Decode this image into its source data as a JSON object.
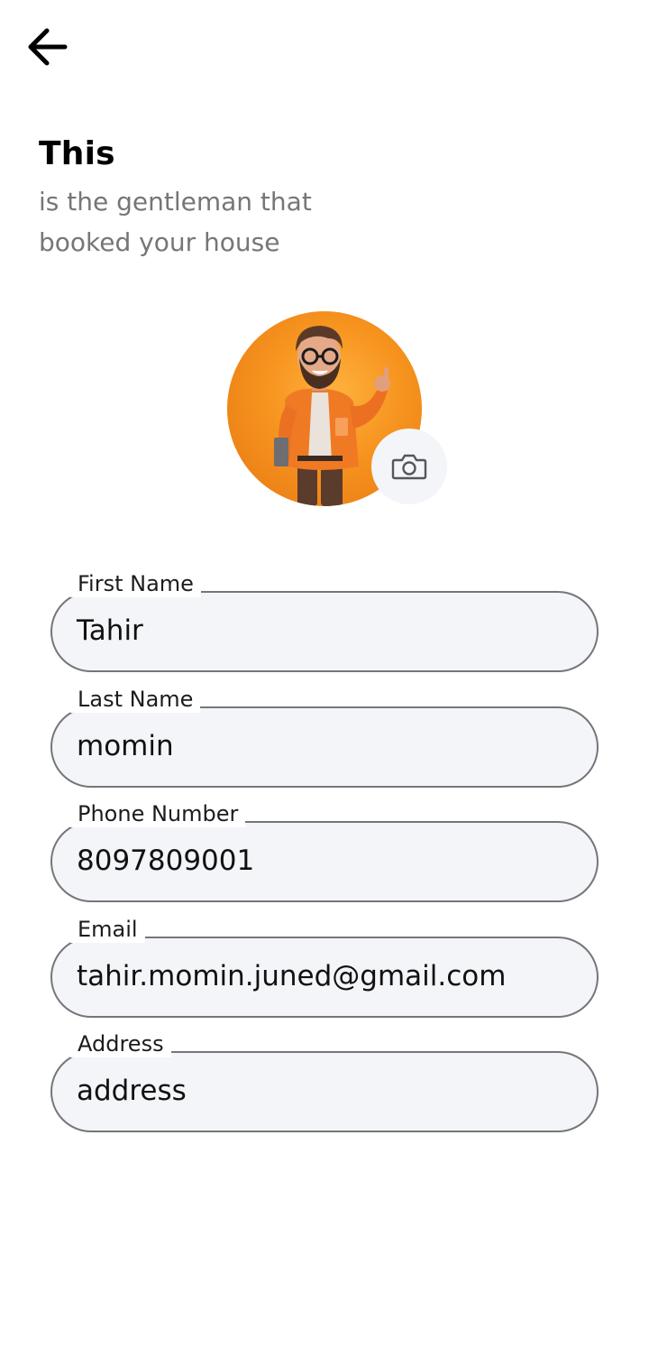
{
  "header": {
    "title": "This",
    "subtitle": "is the gentleman that booked your house"
  },
  "icons": {
    "back": "arrow-left-icon",
    "camera": "camera-icon"
  },
  "colors": {
    "accent_orange": "#f6931e",
    "field_background": "#f4f5f9",
    "field_border": "#76767a",
    "subtitle_text": "#767676"
  },
  "form": {
    "fields": [
      {
        "label": "First Name",
        "value": "Tahir"
      },
      {
        "label": "Last Name",
        "value": "momin"
      },
      {
        "label": "Phone Number",
        "value": "8097809001"
      },
      {
        "label": "Email",
        "value": "tahir.momin.juned@gmail.com"
      },
      {
        "label": "Address",
        "value": "address"
      }
    ]
  }
}
